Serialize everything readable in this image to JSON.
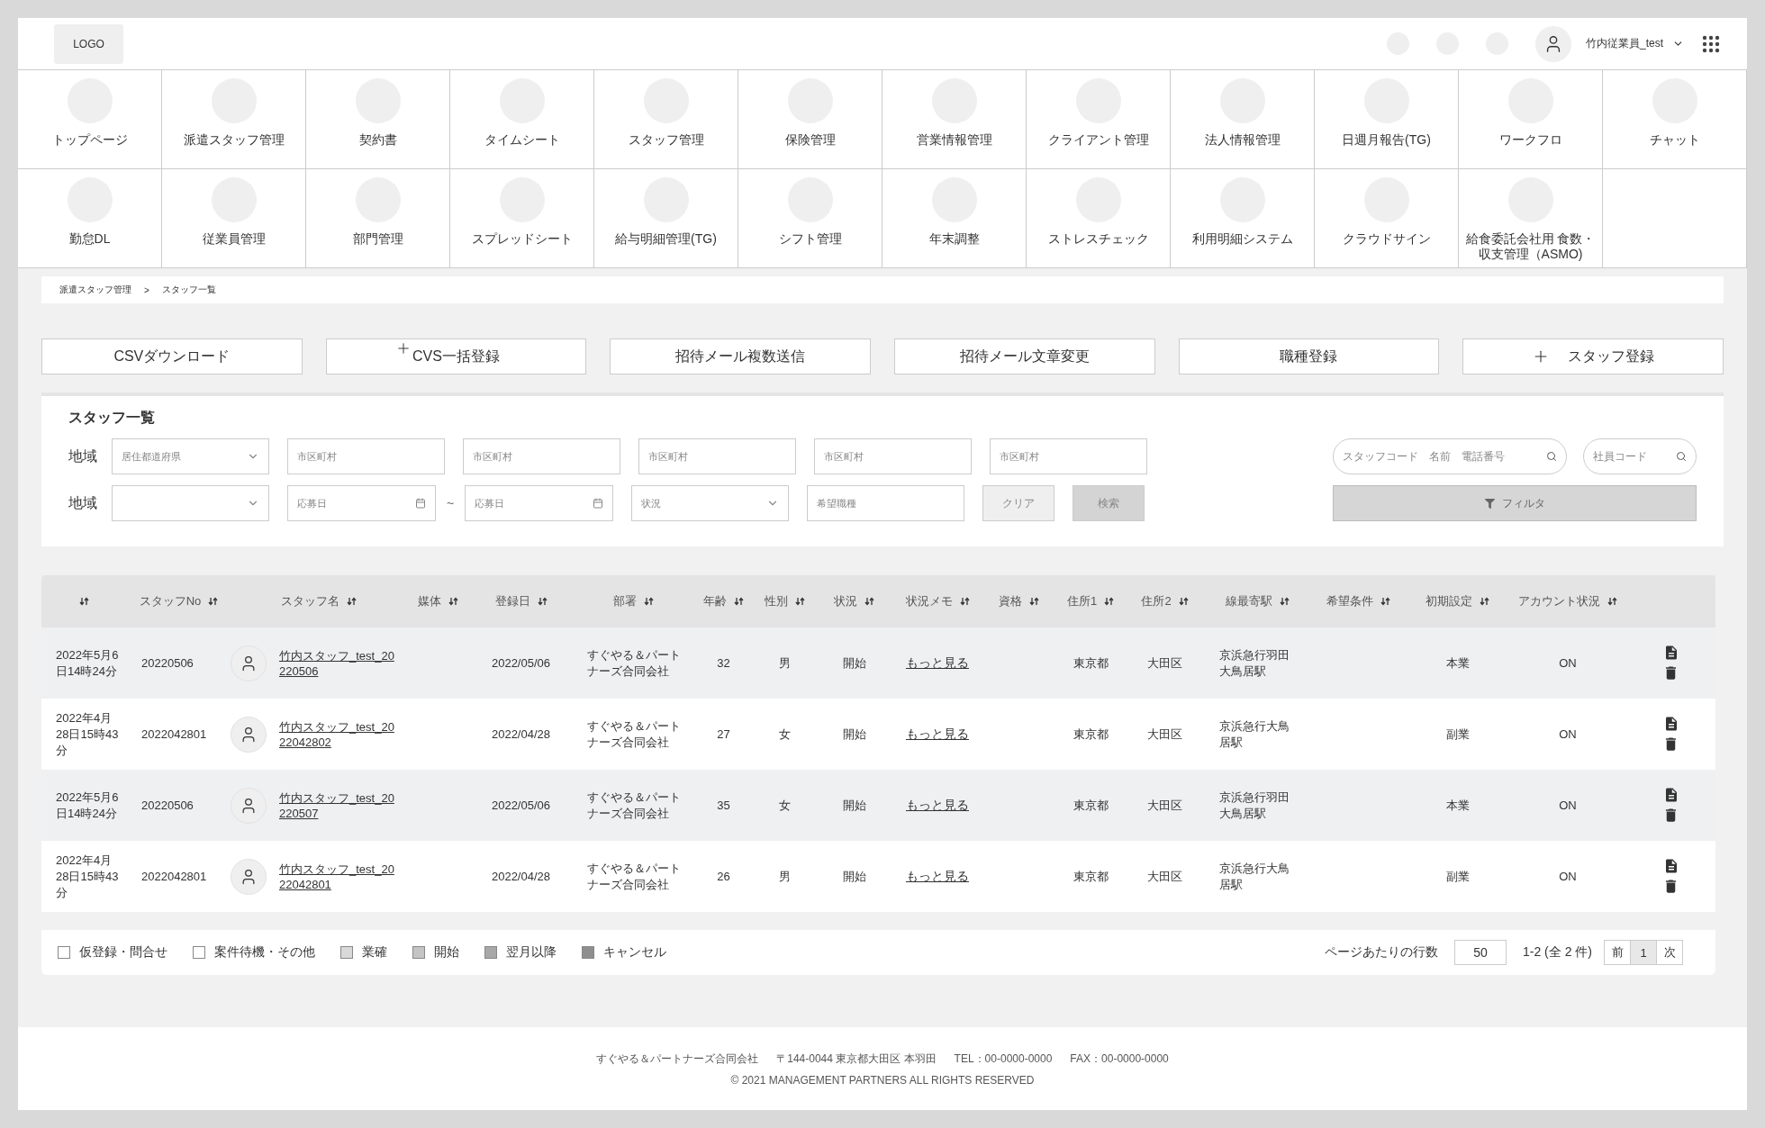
{
  "header": {
    "logo": "LOGO",
    "user_name": "竹内従業員_test"
  },
  "nav": [
    {
      "label": "トップページ"
    },
    {
      "label": "派遣スタッフ管理"
    },
    {
      "label": "契約書"
    },
    {
      "label": "タイムシート"
    },
    {
      "label": "スタッフ管理"
    },
    {
      "label": "保険管理"
    },
    {
      "label": "営業情報管理"
    },
    {
      "label": "クライアント管理"
    },
    {
      "label": "法人情報管理"
    },
    {
      "label": "日週月報告(TG)"
    },
    {
      "label": "ワークフロ"
    },
    {
      "label": "チャット"
    },
    {
      "label": "勤怠DL"
    },
    {
      "label": "従業員管理"
    },
    {
      "label": "部門管理"
    },
    {
      "label": "スプレッドシート"
    },
    {
      "label": "給与明細管理(TG)"
    },
    {
      "label": "シフト管理"
    },
    {
      "label": "年末調整"
    },
    {
      "label": "ストレスチェック"
    },
    {
      "label": "利用明細システム"
    },
    {
      "label": "クラウドサイン"
    },
    {
      "label": "給食委託会社用 食数・収支管理（ASMO)"
    }
  ],
  "breadcrumb": {
    "items": [
      "派遣スタッフ管理",
      "スタッフ一覧"
    ],
    "separator": ">"
  },
  "actions": [
    {
      "label": "CSVダウンロード",
      "kind": "plain"
    },
    {
      "label": "CVS一括登録",
      "kind": "plus-above"
    },
    {
      "label": "招待メール複数送信",
      "kind": "plain"
    },
    {
      "label": "招待メール文章変更",
      "kind": "plain"
    },
    {
      "label": "職種登録",
      "kind": "plain"
    },
    {
      "label": "スタッフ登録",
      "kind": "plus-inline"
    }
  ],
  "filters": {
    "title": "スタッフ一覧",
    "rows": [
      {
        "label": "地域",
        "fields": [
          {
            "kind": "select",
            "placeholder": "居住都道府県"
          },
          {
            "kind": "text",
            "placeholder": "市区町村"
          },
          {
            "kind": "text",
            "placeholder": "市区町村"
          },
          {
            "kind": "text",
            "placeholder": "市区町村"
          },
          {
            "kind": "text",
            "placeholder": "市区町村"
          },
          {
            "kind": "text",
            "placeholder": "市区町村"
          }
        ],
        "side": [
          {
            "kind": "search",
            "placeholder": "スタッフコード　名前　電話番号"
          },
          {
            "kind": "search",
            "placeholder": "社員コード"
          }
        ]
      },
      {
        "label": "地域",
        "fields": [
          {
            "kind": "select"
          },
          {
            "kind": "date",
            "placeholder": "応募日"
          },
          {
            "kind": "tilde",
            "text": "~"
          },
          {
            "kind": "date",
            "placeholder": "応募日"
          },
          {
            "kind": "select",
            "placeholder": "状況"
          },
          {
            "kind": "text",
            "placeholder": "希望職種"
          },
          {
            "kind": "button-light",
            "label": "クリア"
          },
          {
            "kind": "button-dark",
            "label": "検索"
          }
        ],
        "side": [
          {
            "kind": "filter",
            "label": "フィルタ"
          }
        ]
      }
    ]
  },
  "table": {
    "columns": [
      "",
      "スタッフNo",
      "スタッフ名",
      "媒体",
      "登録日",
      "部署",
      "年齢",
      "性別",
      "状況",
      "状況メモ",
      "資格",
      "住所1",
      "住所2",
      "線最寄駅",
      "希望条件",
      "初期設定",
      "アカウント状況"
    ],
    "rows": [
      {
        "created": "2022年5月6日14時24分",
        "no": "20220506",
        "name": "竹内スタッフ_test_20220506",
        "date": "2022/05/06",
        "dept": "すぐやる＆パートナーズ合同会社",
        "age": "32",
        "gender": "男",
        "status": "開始",
        "memo": "もっと見る",
        "addr1": "東京都",
        "addr2": "大田区",
        "station": "京浜急行羽田大鳥居駅",
        "setting": "本業",
        "account": "ON"
      },
      {
        "created": "2022年4月28日15時43分",
        "no": "2022042801",
        "name": "竹内スタッフ_test_2022042802",
        "date": "2022/04/28",
        "dept": "すぐやる＆パートナーズ合同会社",
        "age": "27",
        "gender": "女",
        "status": "開始",
        "memo": "もっと見る",
        "addr1": "東京都",
        "addr2": "大田区",
        "station": "京浜急行大鳥居駅",
        "setting": "副業",
        "account": "ON"
      },
      {
        "created": "2022年5月6日14時24分",
        "no": "20220506",
        "name": "竹内スタッフ_test_20220507",
        "date": "2022/05/06",
        "dept": "すぐやる＆パートナーズ合同会社",
        "age": "35",
        "gender": "女",
        "status": "開始",
        "memo": "もっと見る",
        "addr1": "東京都",
        "addr2": "大田区",
        "station": "京浜急行羽田大鳥居駅",
        "setting": "本業",
        "account": "ON"
      },
      {
        "created": "2022年4月28日15時43分",
        "no": "2022042801",
        "name": "竹内スタッフ_test_2022042801",
        "date": "2022/04/28",
        "dept": "すぐやる＆パートナーズ合同会社",
        "age": "26",
        "gender": "男",
        "status": "開始",
        "memo": "もっと見る",
        "addr1": "東京都",
        "addr2": "大田区",
        "station": "京浜急行大鳥居駅",
        "setting": "副業",
        "account": "ON"
      }
    ]
  },
  "legend": [
    {
      "label": "仮登録・問合せ",
      "color": "#ffffff"
    },
    {
      "label": "案件待機・その他",
      "color": "#ffffff"
    },
    {
      "label": "業確",
      "color": "#d9d9d9"
    },
    {
      "label": "開始",
      "color": "#c4c4c4"
    },
    {
      "label": "翌月以降",
      "color": "#a8a8a8"
    },
    {
      "label": "キャンセル",
      "color": "#8f8f8f"
    }
  ],
  "pagination": {
    "rows_label": "ページあたりの行数",
    "rows_value": "50",
    "range": "1-2 (全 2 件)",
    "prev": "前",
    "pages": [
      {
        "label": "1",
        "selected": true
      }
    ],
    "next": "次"
  },
  "footer": {
    "company": "すぐやる＆パートナーズ合同会社",
    "address": "〒144-0044 東京都大田区 本羽田",
    "tel": "TEL：00-0000-0000",
    "fax": "FAX：00-0000-0000",
    "copyright": "© 2021 MANAGEMENT PARTNERS ALL RIGHTS RESERVED"
  }
}
